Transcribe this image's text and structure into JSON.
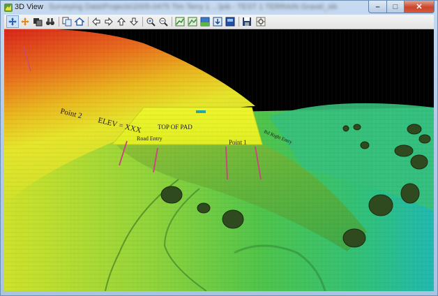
{
  "window": {
    "title": "3D View",
    "path_text": "- Surveying Data\\Projects\\2005-0475 Tim Terry 1 ...\\job - TEST 1 TERRAIN Gravel_site_Samples.terrain",
    "controls": {
      "minimize_glyph": "–",
      "maximize_glyph": "□",
      "close_glyph": "✕"
    }
  },
  "toolbar": {
    "buttons": [
      {
        "id": "rotate",
        "icon": "rotate-arrows-icon"
      },
      {
        "id": "pan",
        "icon": "pan-arrows-icon"
      },
      {
        "id": "layers",
        "icon": "layers-icon"
      },
      {
        "id": "binoculars",
        "icon": "binoculars-icon"
      },
      {
        "id": "copy",
        "icon": "copy-icon"
      },
      {
        "id": "home",
        "icon": "home-icon"
      },
      {
        "id": "left",
        "icon": "arrow-left-icon"
      },
      {
        "id": "right",
        "icon": "arrow-right-icon"
      },
      {
        "id": "up",
        "icon": "arrow-up-icon"
      },
      {
        "id": "down",
        "icon": "arrow-down-icon"
      },
      {
        "id": "zoom-in",
        "icon": "zoom-in-icon"
      },
      {
        "id": "zoom-out",
        "icon": "zoom-out-icon"
      },
      {
        "id": "view-surface-1",
        "icon": "surface-view-icon"
      },
      {
        "id": "view-surface-2",
        "icon": "surface-grid-icon"
      },
      {
        "id": "view-color",
        "icon": "color-surface-icon"
      },
      {
        "id": "view-elev",
        "icon": "elevation-icon"
      },
      {
        "id": "view-shaded",
        "icon": "shaded-view-icon"
      },
      {
        "id": "save",
        "icon": "save-icon"
      },
      {
        "id": "settings",
        "icon": "settings-icon"
      }
    ]
  },
  "scene": {
    "labels": {
      "point2": "Point 2",
      "elev": "ELEV = XXX",
      "top_of_pad": "TOP OF PAD",
      "road_entry": "Road Entry",
      "point1": "Point 1",
      "right_label": "Rd Right Entry"
    },
    "colors": {
      "pad": "#e9f524",
      "high": "#e0261a",
      "mid": "#e9e01e",
      "low": "#3fc24a",
      "lowest": "#1fb8b0"
    }
  }
}
